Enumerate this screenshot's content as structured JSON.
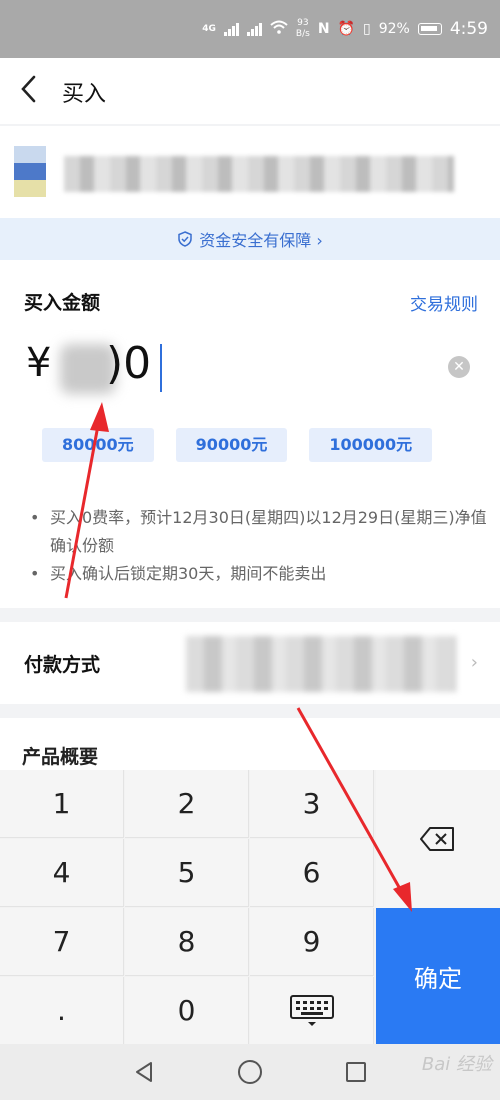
{
  "status_bar": {
    "network": "4G",
    "speed_value": "93",
    "speed_unit": "B/s",
    "battery": "92%",
    "time": "4:59"
  },
  "header": {
    "back_icon": "chevron-left-icon",
    "title": "买入"
  },
  "safety_banner": {
    "icon": "shield-check-icon",
    "text": "资金安全有保障 ›"
  },
  "amount": {
    "label": "买入金额",
    "rules_link": "交易规则",
    "currency": "¥",
    "visible_value": ")0",
    "quick_amounts": [
      "80000元",
      "90000元",
      "100000元"
    ]
  },
  "notes": [
    "买入0费率，预计12月30日(星期四)以12月29日(星期三)净值确认份额",
    "买入确认后锁定期30天，期间不能卖出"
  ],
  "payment": {
    "label": "付款方式"
  },
  "overview": {
    "label": "产品概要"
  },
  "keypad": {
    "keys": [
      "1",
      "2",
      "3",
      "4",
      "5",
      "6",
      "7",
      "8",
      "9",
      ".",
      "0"
    ],
    "delete_icon": "backspace-icon",
    "keyboard_icon": "keyboard-icon",
    "confirm_label": "确定",
    "confirm_color": "#2a7af3"
  },
  "navbar": {
    "watermark": "Bai 经验"
  },
  "colors": {
    "accent": "#2f6fdb",
    "annotation": "#e8282c"
  }
}
